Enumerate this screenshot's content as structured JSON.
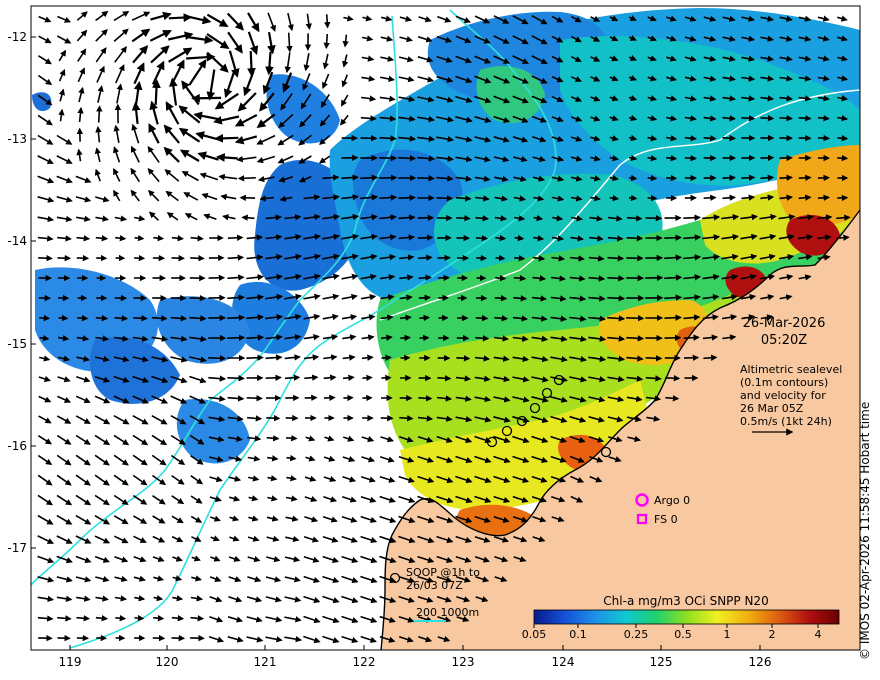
{
  "map": {
    "datetime_line1": "26-Mar-2026",
    "datetime_line2": "05:20Z",
    "info_lines": [
      "Altimetric sealevel",
      "(0.1m contours)",
      "and velocity for",
      "26 Mar 05Z",
      "0.5m/s (1kt 24h)"
    ],
    "copyright": "© IMOS 02-Apr-2026 11:58:45 Hobart time",
    "x_ticks": [
      "119",
      "120",
      "121",
      "122",
      "123",
      "124",
      "125",
      "126"
    ],
    "y_ticks": [
      "-12",
      "-13",
      "-14",
      "-15",
      "-16",
      "-17"
    ],
    "legend": {
      "argo": "Argo 0",
      "fs": "FS 0",
      "soop_line1": "SOOP @1h to",
      "soop_line2": "26/03 07Z",
      "bathy": "200  1000m"
    },
    "colorbar": {
      "title": "Chl-a mg/m3 OCi SNPP N20",
      "ticks": [
        "0.05",
        "0.1",
        "0.25",
        "0.5",
        "1",
        "2",
        "4"
      ],
      "colors": [
        "#0a1a8c",
        "#1450d8",
        "#1e90e8",
        "#10c8d0",
        "#20d070",
        "#8ce020",
        "#f0f020",
        "#f0b010",
        "#e06010",
        "#b01010",
        "#6a0000"
      ]
    },
    "colors": {
      "land": "#f8c9a0",
      "contour": "#2ee0e0",
      "argo": "#ff00ff"
    }
  }
}
